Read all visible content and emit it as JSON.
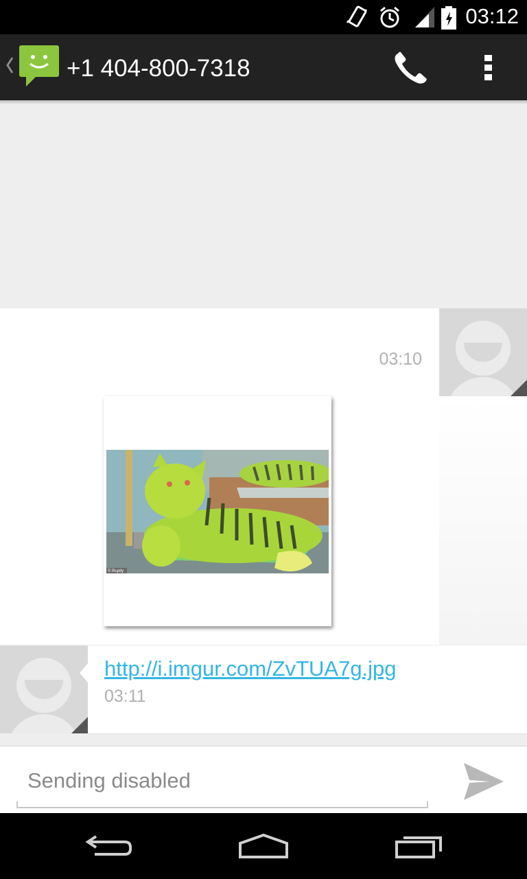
{
  "status_bar": {
    "time": "03:12"
  },
  "header": {
    "title": "+1 404-800-7318"
  },
  "conversation": {
    "messages": [
      {
        "direction": "outgoing",
        "time": "03:10",
        "attachment": "photo",
        "watermark": "© Ruptly"
      },
      {
        "direction": "incoming",
        "text": "http://i.imgur.com/ZvTUA7g.jpg",
        "time": "03:11"
      }
    ]
  },
  "compose": {
    "placeholder": "Sending disabled"
  },
  "colors": {
    "link": "#33b5e5",
    "app_icon": "#8cc63e",
    "action_bar": "#222222"
  },
  "icons": [
    "vibrate-icon",
    "alarm-icon",
    "signal-icon",
    "battery-icon",
    "back-caret-icon",
    "messaging-app-icon",
    "phone-icon",
    "overflow-menu-icon",
    "send-icon",
    "nav-back-icon",
    "nav-home-icon",
    "nav-recents-icon"
  ]
}
